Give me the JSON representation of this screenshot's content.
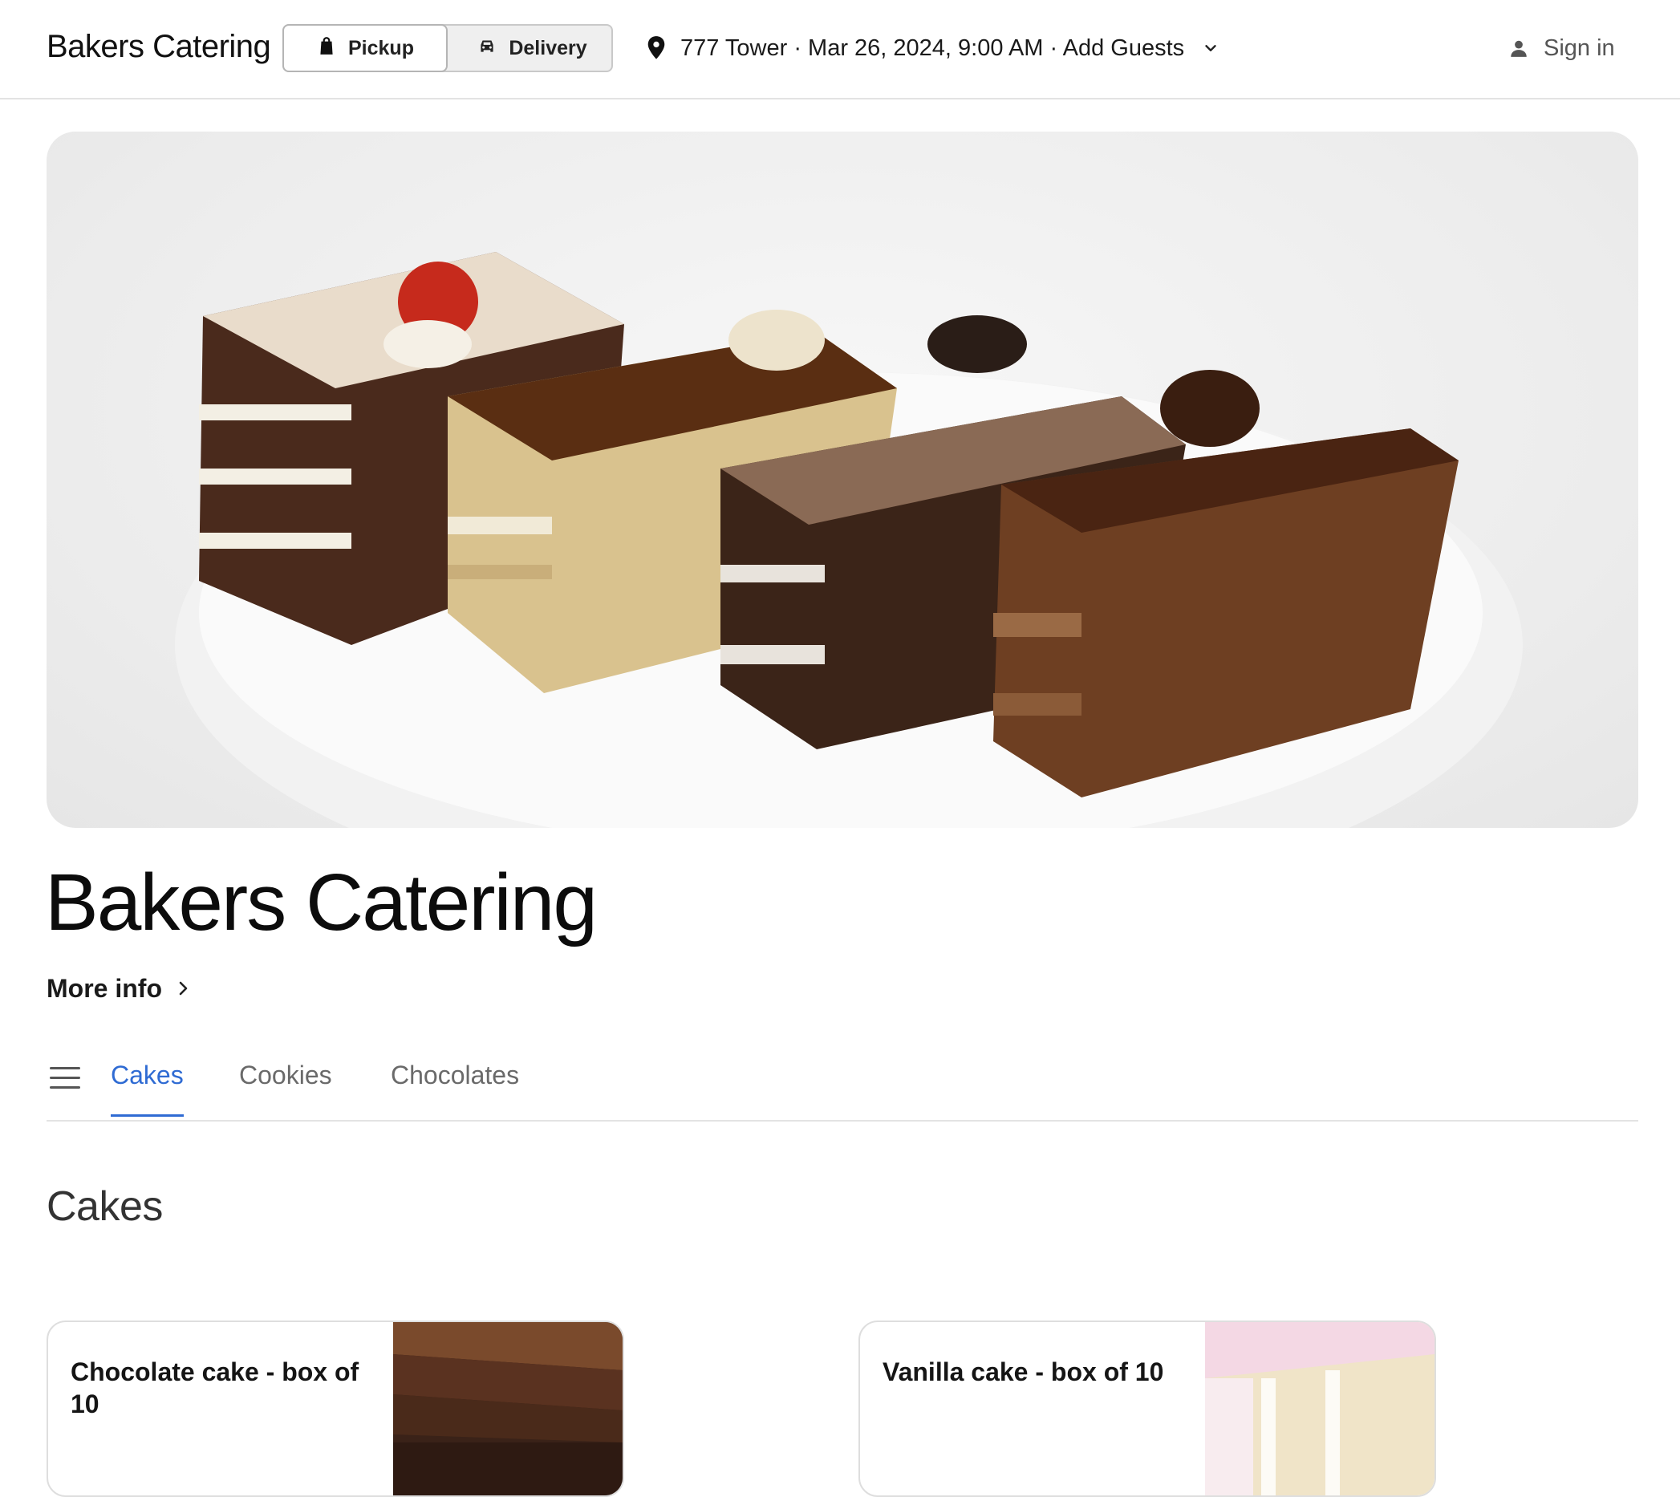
{
  "header": {
    "brand": "Bakers Catering",
    "pickup_label": "Pickup",
    "delivery_label": "Delivery",
    "order_context": "777 Tower · Mar 26, 2024, 9:00 AM · Add Guests",
    "signin_label": "Sign in",
    "selected_mode": "Pickup"
  },
  "store": {
    "title": "Bakers Catering",
    "more_info_label": "More info"
  },
  "tabs": [
    {
      "label": "Cakes",
      "active": true
    },
    {
      "label": "Cookies",
      "active": false
    },
    {
      "label": "Chocolates",
      "active": false
    }
  ],
  "section": {
    "title": "Cakes"
  },
  "items": [
    {
      "name": "Chocolate cake - box of 10",
      "image_icon": "chocolate-cake-photo"
    },
    {
      "name": "Vanilla cake - box of 10",
      "image_icon": "vanilla-cake-photo"
    }
  ],
  "colors": {
    "accent": "#2f6bd3",
    "text": "#111111",
    "muted": "#6a6a6a",
    "divider": "#e3e3e3"
  }
}
